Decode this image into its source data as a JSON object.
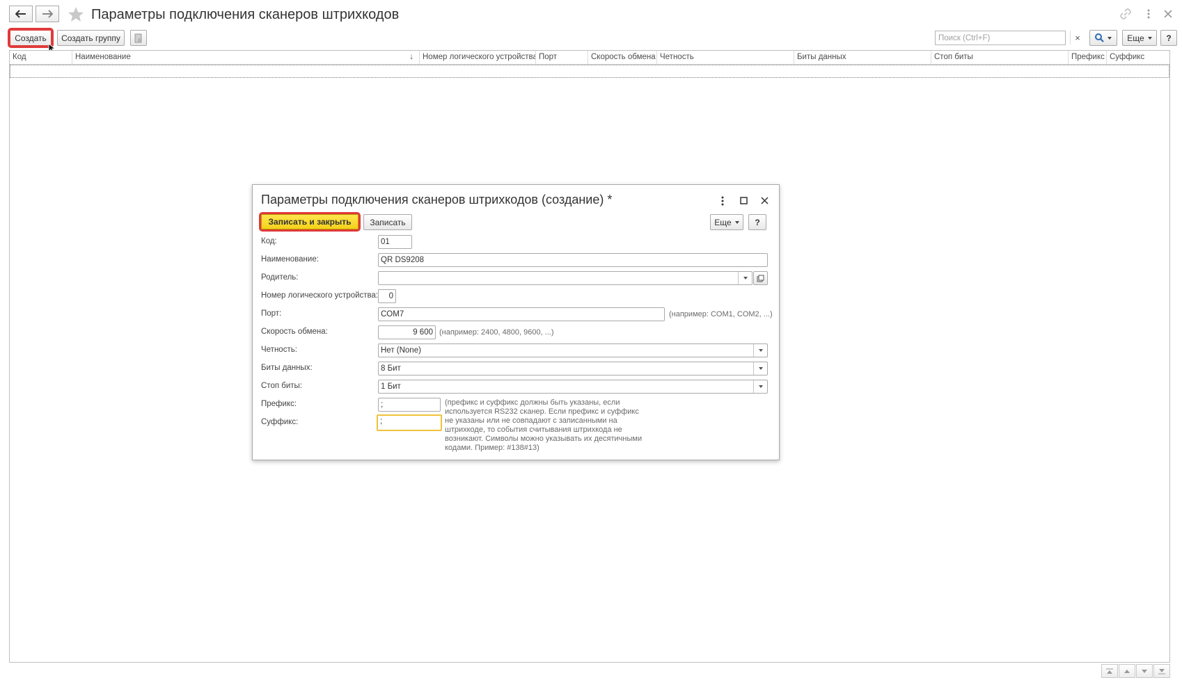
{
  "header": {
    "title": "Параметры подключения сканеров штрихкодов"
  },
  "toolbar": {
    "create_label": "Создать",
    "create_group_label": "Создать группу",
    "search_placeholder": "Поиск (Ctrl+F)",
    "search_clear": "×",
    "more_label": "Еще",
    "help_label": "?"
  },
  "table": {
    "columns": [
      "Код",
      "Наименование",
      "Номер логического устройства",
      "Порт",
      "Скорость обмена",
      "Четность",
      "Биты данных",
      "Стоп биты",
      "Префикс",
      "Суффикс"
    ],
    "sort_indicator": "↓"
  },
  "dialog": {
    "title": "Параметры подключения сканеров штрихкодов (создание) *",
    "save_close_label": "Записать и закрыть",
    "save_label": "Записать",
    "more_label": "Еще",
    "help_label": "?",
    "fields": {
      "code": {
        "label": "Код:",
        "value": "01"
      },
      "name": {
        "label": "Наименование:",
        "value": "QR DS9208"
      },
      "parent": {
        "label": "Родитель:",
        "value": ""
      },
      "device_number": {
        "label": "Номер логического устройства:",
        "value": "0"
      },
      "port": {
        "label": "Порт:",
        "value": "COM7",
        "hint": "(например: COM1, COM2, ...)"
      },
      "speed": {
        "label": "Скорость обмена:",
        "value": "9 600",
        "hint": "(например: 2400, 4800, 9600, ...)"
      },
      "parity": {
        "label": "Четность:",
        "value": "Нет (None)"
      },
      "data_bits": {
        "label": "Биты данных:",
        "value": "8 Бит"
      },
      "stop_bits": {
        "label": "Стоп биты:",
        "value": "1 Бит"
      },
      "prefix": {
        "label": "Префикс:",
        "value": ";"
      },
      "suffix": {
        "label": "Суффикс:",
        "value": ";"
      }
    },
    "note": "(префикс и суффикс должны быть указаны, если используется RS232 сканер. Если префикс и суффикс не указаны или не совпадают с записанными на штрихкоде, то события считывания штрихкода не возникают. Символы можно указывать их десятичными кодами. Пример: #138#13)"
  },
  "colors": {
    "accent_yellow": "#f4d21a",
    "highlight_red": "#e03a3a",
    "focus_yellow": "#f0c23c"
  }
}
